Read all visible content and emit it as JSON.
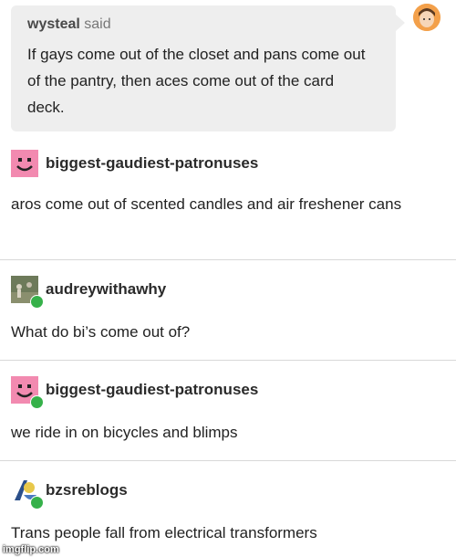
{
  "quote": {
    "author": "wysteal",
    "said": "said",
    "text": "If gays come out of the closet and pans come out of the pantry, then aces come out of the card deck."
  },
  "posts": [
    {
      "username": "biggest-gaudiest-patronuses",
      "text": "aros come out of scented candles and air freshener cans",
      "avatar_icon": "pink-smiley-avatar",
      "reblog": false
    },
    {
      "username": "audreywithawhy",
      "text": "What do bi’s come out of?",
      "avatar_icon": "photo-avatar",
      "reblog": true
    },
    {
      "username": "biggest-gaudiest-patronuses",
      "text": "we ride in on bicycles and blimps",
      "avatar_icon": "pink-smiley-avatar",
      "reblog": true
    },
    {
      "username": "bzsreblogs",
      "text": "Trans people fall from electrical transformers",
      "avatar_icon": "cartoon-avatar",
      "reblog": true
    }
  ],
  "watermark": "imgflip.com",
  "colors": {
    "bubble": "#eeeeee",
    "reblog_badge": "#36b14a",
    "pink_avatar": "#f28ab0"
  }
}
